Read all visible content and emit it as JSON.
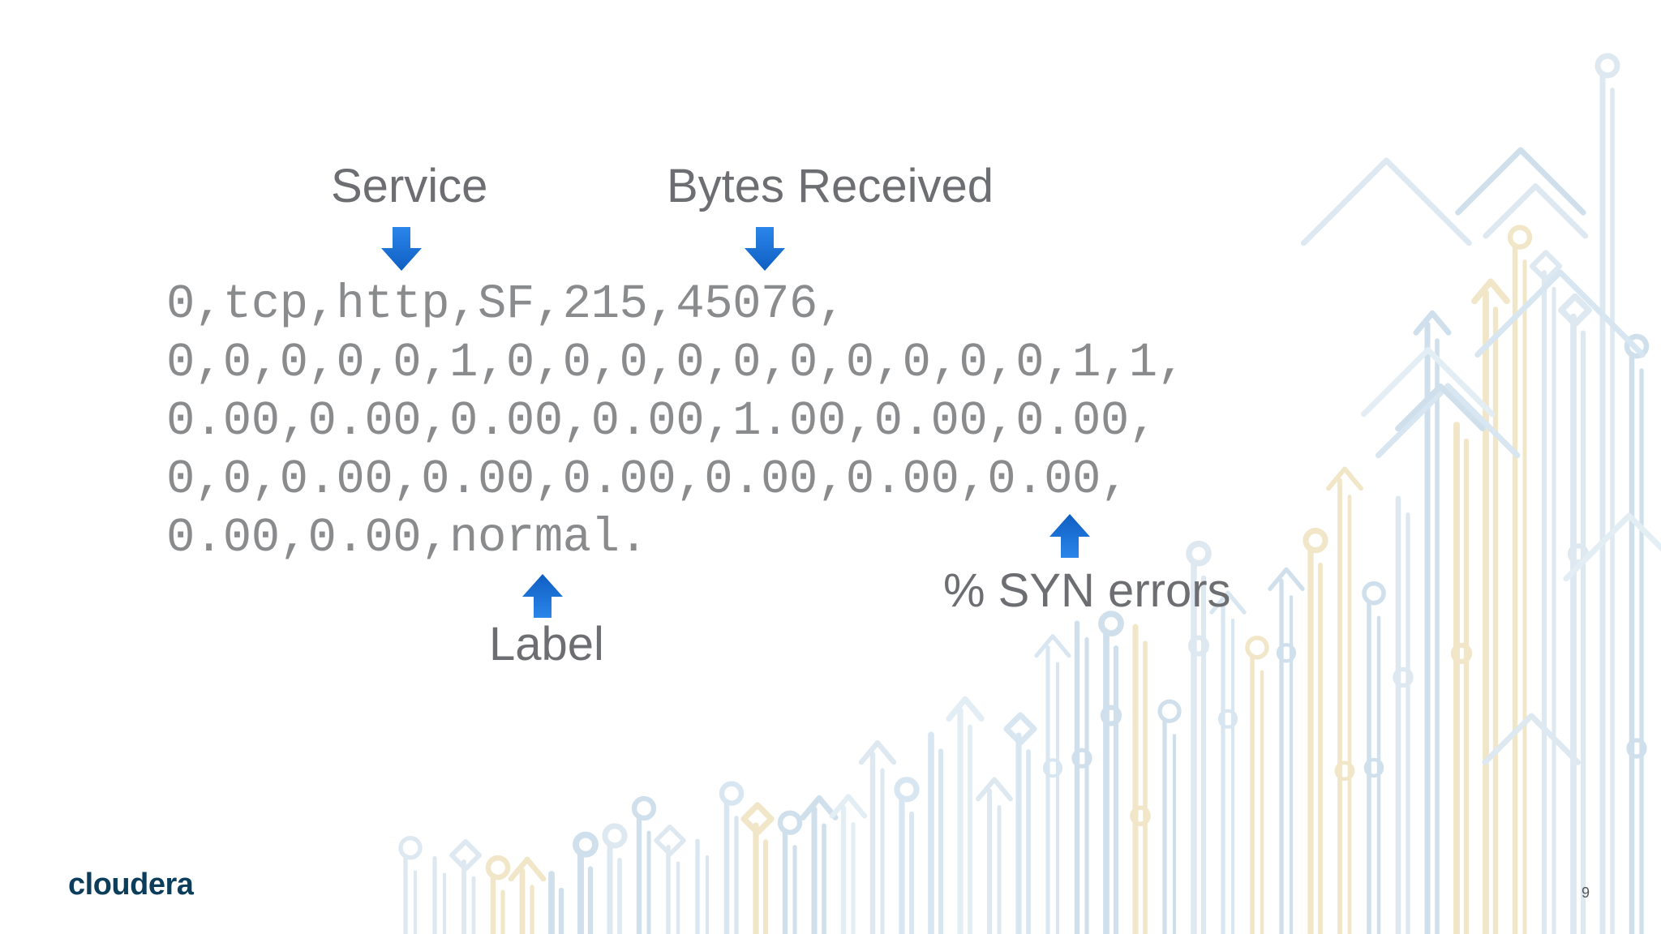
{
  "slide": {
    "annotations": {
      "service": "Service",
      "bytes_received": "Bytes Received",
      "syn_errors": "% SYN errors",
      "label": "Label"
    },
    "record_lines": [
      "0,tcp,http,SF,215,45076,",
      "0,0,0,0,0,1,0,0,0,0,0,0,0,0,0,0,1,1,",
      "0.00,0.00,0.00,0.00,1.00,0.00,0.00,",
      "0,0,0.00,0.00,0.00,0.00,0.00,0.00,",
      "0.00,0.00,normal."
    ],
    "logo_text": "cloudera",
    "page_number": "9"
  },
  "icons": {
    "down_arrow": "arrow-down-icon",
    "up_arrow": "arrow-up-icon"
  },
  "colors": {
    "annotation_text": "#6d6e71",
    "record_text": "#8a8b8d",
    "arrow_blue": "#1f6fd6",
    "logo": "#0c3e5c",
    "background_art": "#cfe0ec"
  }
}
